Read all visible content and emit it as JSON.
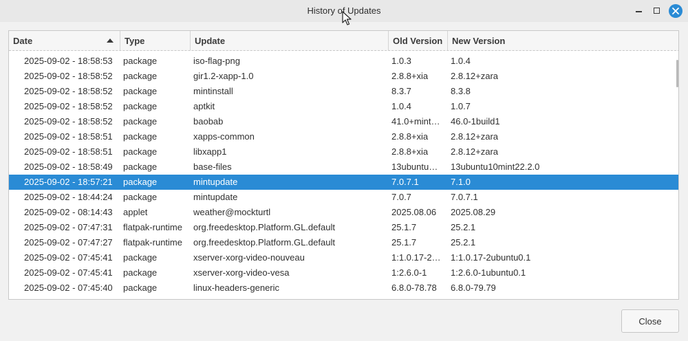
{
  "window": {
    "title": "History of Updates",
    "icons": {
      "minimize": "minimize-icon",
      "maximize": "maximize-icon",
      "close": "close-icon"
    },
    "accent_color": "#2a8bd5"
  },
  "table": {
    "columns": {
      "date": "Date",
      "type": "Type",
      "update": "Update",
      "old_version": "Old Version",
      "new_version": "New Version"
    },
    "sort_icon": "sort-ascending-icon",
    "selected_index": 8,
    "rows": [
      {
        "date": "2025-09-02 - 18:58:53",
        "type": "package",
        "update": "iso-flag-png",
        "old": "1.0.3",
        "new": "1.0.4"
      },
      {
        "date": "2025-09-02 - 18:58:52",
        "type": "package",
        "update": "gir1.2-xapp-1.0",
        "old": "2.8.8+xia",
        "new": "2.8.12+zara"
      },
      {
        "date": "2025-09-02 - 18:58:52",
        "type": "package",
        "update": "mintinstall",
        "old": "8.3.7",
        "new": "8.3.8"
      },
      {
        "date": "2025-09-02 - 18:58:52",
        "type": "package",
        "update": "aptkit",
        "old": "1.0.4",
        "new": "1.0.7"
      },
      {
        "date": "2025-09-02 - 18:58:52",
        "type": "package",
        "update": "baobab",
        "old": "41.0+mint…",
        "new": "46.0-1build1"
      },
      {
        "date": "2025-09-02 - 18:58:51",
        "type": "package",
        "update": "xapps-common",
        "old": "2.8.8+xia",
        "new": "2.8.12+zara"
      },
      {
        "date": "2025-09-02 - 18:58:51",
        "type": "package",
        "update": "libxapp1",
        "old": "2.8.8+xia",
        "new": "2.8.12+zara"
      },
      {
        "date": "2025-09-02 - 18:58:49",
        "type": "package",
        "update": "base-files",
        "old": "13ubuntu…",
        "new": "13ubuntu10mint22.2.0"
      },
      {
        "date": "2025-09-02 - 18:57:21",
        "type": "package",
        "update": "mintupdate",
        "old": "7.0.7.1",
        "new": "7.1.0"
      },
      {
        "date": "2025-09-02 - 18:44:24",
        "type": "package",
        "update": "mintupdate",
        "old": "7.0.7",
        "new": "7.0.7.1"
      },
      {
        "date": "2025-09-02 - 08:14:43",
        "type": "applet",
        "update": "weather@mockturtl",
        "old": "2025.08.06",
        "new": "2025.08.29"
      },
      {
        "date": "2025-09-02 - 07:47:31",
        "type": "flatpak-runtime",
        "update": "org.freedesktop.Platform.GL.default",
        "old": "25.1.7",
        "new": "25.2.1"
      },
      {
        "date": "2025-09-02 - 07:47:27",
        "type": "flatpak-runtime",
        "update": "org.freedesktop.Platform.GL.default",
        "old": "25.1.7",
        "new": "25.2.1"
      },
      {
        "date": "2025-09-02 - 07:45:41",
        "type": "package",
        "update": "xserver-xorg-video-nouveau",
        "old": "1:1.0.17-2…",
        "new": "1:1.0.17-2ubuntu0.1"
      },
      {
        "date": "2025-09-02 - 07:45:41",
        "type": "package",
        "update": "xserver-xorg-video-vesa",
        "old": "1:2.6.0-1",
        "new": "1:2.6.0-1ubuntu0.1"
      },
      {
        "date": "2025-09-02 - 07:45:40",
        "type": "package",
        "update": "linux-headers-generic",
        "old": "6.8.0-78.78",
        "new": "6.8.0-79.79"
      },
      {
        "date": "",
        "type": "",
        "update": "",
        "old": "",
        "new": ""
      }
    ]
  },
  "footer": {
    "close_label": "Close"
  }
}
